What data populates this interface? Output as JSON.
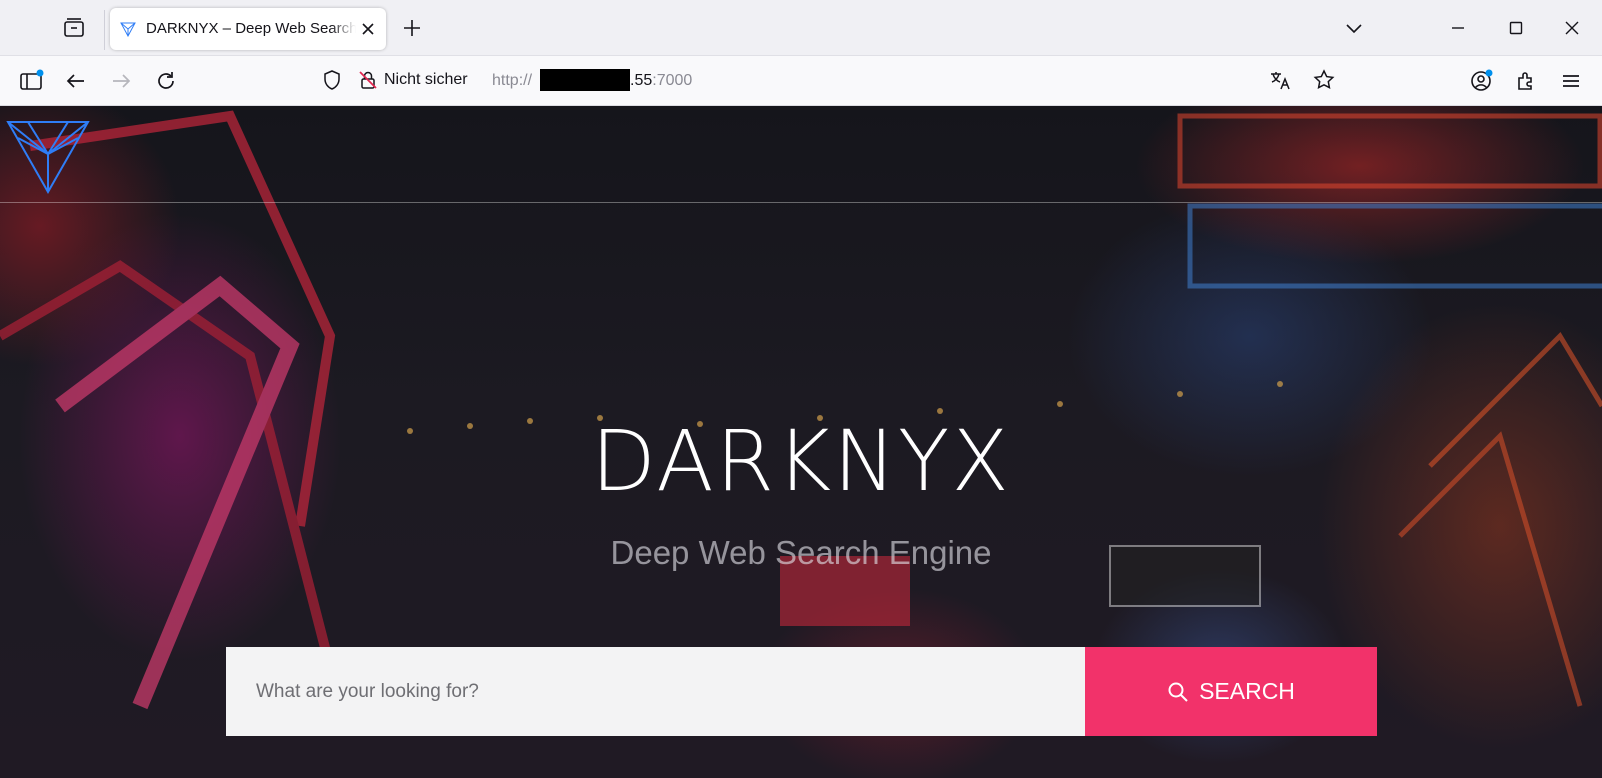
{
  "browser": {
    "tab": {
      "title": "DARKNYX – Deep Web Search Engine",
      "icon": "darknyx-favicon"
    },
    "address": {
      "security_label": "Nicht sicher",
      "url_prefix": "http://",
      "url_suffix": ".55",
      "url_port": ":7000"
    },
    "icons": {
      "tab_list": "tab-list-icon",
      "new_tab": "plus-icon",
      "all_tabs": "chevron-down-icon",
      "minimize": "minimize-icon",
      "maximize": "maximize-icon",
      "close": "close-icon",
      "sidebar": "sidebar-icon",
      "back": "back-arrow-icon",
      "forward": "forward-arrow-icon",
      "reload": "reload-icon",
      "shield": "shield-icon",
      "insecure": "insecure-lock-icon",
      "translate": "translate-icon",
      "bookmark": "star-icon",
      "account": "account-icon",
      "extensions": "extensions-icon",
      "menu": "hamburger-menu-icon"
    }
  },
  "page": {
    "logo": "darknyx-logo",
    "hero_title": "DARKNYX",
    "hero_subtitle": "Deep Web Search Engine",
    "search": {
      "placeholder": "What are your looking for?",
      "value": "",
      "button_label": "SEARCH",
      "button_icon": "search-icon"
    },
    "colors": {
      "accent": "#f2326a",
      "logo_blue": "#2f7df6",
      "input_bg": "#f3f3f4"
    }
  }
}
